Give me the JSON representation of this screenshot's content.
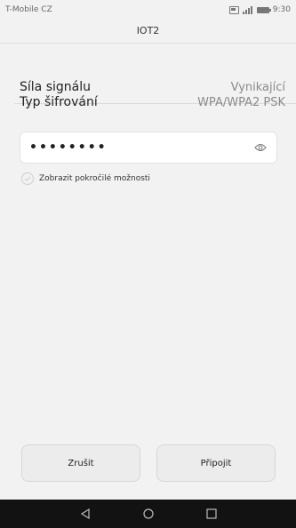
{
  "status_bar": {
    "carrier": "T-Mobile CZ",
    "time": "9:30",
    "icons": [
      "sim-icon",
      "signal-icon",
      "battery-icon"
    ]
  },
  "title": "IOT2",
  "rows": [
    {
      "label": "Síla signálu",
      "value": "Vynikající"
    },
    {
      "label": "Typ šifrování",
      "value": "WPA/WPA2 PSK"
    }
  ],
  "password": {
    "value": "••••••••",
    "icon": "eye-icon"
  },
  "advanced_option": {
    "label": "Zobrazit pokročilé možnosti",
    "checked": false
  },
  "buttons": {
    "cancel": "Zrušit",
    "connect": "Připojit"
  },
  "navigation": [
    "back-icon",
    "home-icon",
    "recents-icon"
  ],
  "colors": {
    "background": "#f2f2f2",
    "nav_bar": "#121212",
    "value_text": "#8a8a8a"
  }
}
